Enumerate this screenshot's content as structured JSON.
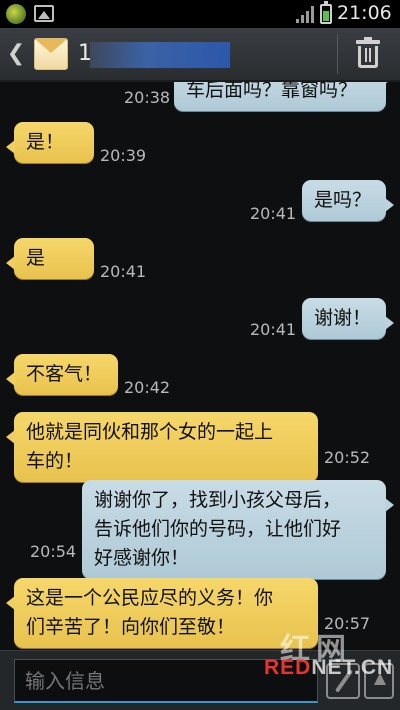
{
  "status_bar": {
    "time": "21:06",
    "icons": [
      "app-notification-icon",
      "gallery-icon",
      "signal-icon",
      "battery-icon"
    ]
  },
  "header": {
    "contact_name": "1",
    "back_icon": "chevron-left-icon",
    "avatar_icon": "envelope-icon",
    "delete_icon": "trash-icon"
  },
  "messages": [
    {
      "direction": "out",
      "text": "车后面吗？靠窗吗？",
      "time": "20:38"
    },
    {
      "direction": "in",
      "text": "是！",
      "time": "20:39"
    },
    {
      "direction": "out",
      "text": "是吗？",
      "time": "20:41"
    },
    {
      "direction": "in",
      "text": "是",
      "time": "20:41"
    },
    {
      "direction": "out",
      "text": "谢谢！",
      "time": "20:41"
    },
    {
      "direction": "in",
      "text": "不客气！",
      "time": "20:42"
    },
    {
      "direction": "in",
      "text_lines": [
        "他就是同伙和那个女的一起上",
        "车的！"
      ],
      "time": "20:52"
    },
    {
      "direction": "out",
      "text_lines": [
        "谢谢你了，找到小孩父母后，",
        "告诉他们你的号码，让他们好",
        "好感谢你！"
      ],
      "time": "20:54"
    },
    {
      "direction": "in",
      "text_lines": [
        "这是一个公民应尽的义务！你",
        "们辛苦了！向你们至敬！"
      ],
      "time": "20:57"
    }
  ],
  "input": {
    "placeholder": "输入信息",
    "attach_icon": "paperclip-icon",
    "send_icon": "send-icon"
  },
  "watermark": {
    "cn": "红网",
    "en_red": "RED",
    "en_rest": "NET.CN"
  },
  "colors": {
    "incoming_bubble": "#f0cf60",
    "outgoing_bubble": "#bcd3de",
    "background": "#0e0f11",
    "input_accent": "#2f9bd0"
  }
}
